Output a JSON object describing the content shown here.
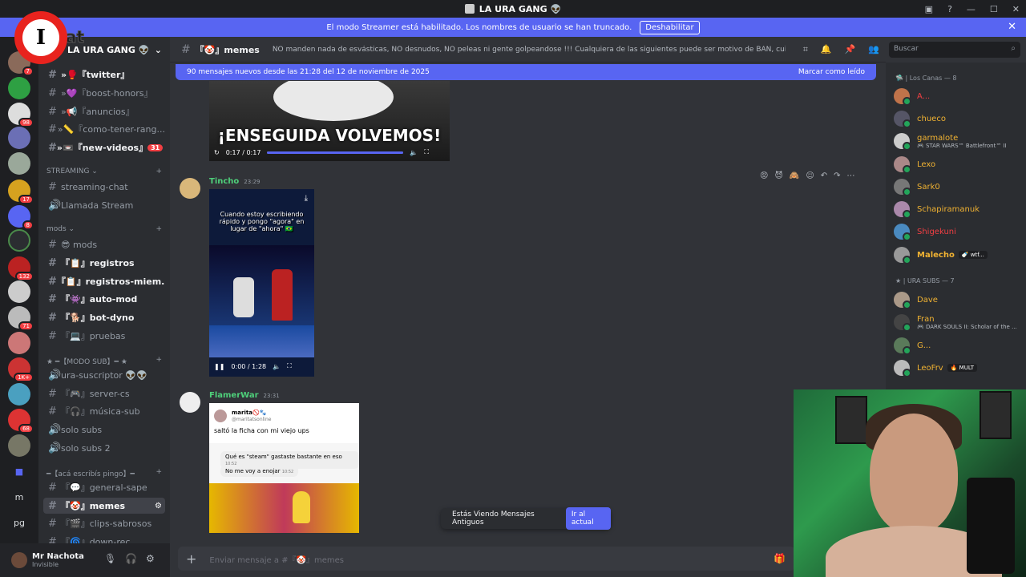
{
  "titlebar": {
    "title": "LA URA GANG 👽"
  },
  "banner": {
    "text": "El modo Streamer está habilitado. Los nombres de usuario se han truncado.",
    "button": "Deshabilitar",
    "close": "✕"
  },
  "logo": {
    "letter": "I",
    "text": "sat"
  },
  "server_badges": [
    "7",
    "98",
    "17",
    "8",
    "132",
    "71",
    "1K+",
    "68"
  ],
  "server_text": [
    "m",
    "pg"
  ],
  "guild": {
    "name": "LA URA GANG 👽"
  },
  "channels": {
    "top": [
      {
        "label": "»🥊『twitter』",
        "bold": true
      },
      {
        "label": "»💜『boost-honors』",
        "bold": false
      },
      {
        "label": "»📢『anuncios』",
        "bold": false
      },
      {
        "label": "»📏『como-tener-rang...",
        "bold": false
      },
      {
        "label": "»📼『new-videos』",
        "bold": true,
        "count": "31"
      }
    ],
    "streaming_cat": "STREAMING ⌄",
    "streaming": [
      "streaming-chat",
      "Llamada Stream"
    ],
    "mods_cat": "mods ⌄",
    "mods": [
      {
        "label": "😎 mods",
        "bold": false
      },
      {
        "label": "『📋』registros",
        "bold": true
      },
      {
        "label": "『📋』registros-miem...",
        "bold": true
      },
      {
        "label": "『👾』auto-mod",
        "bold": true
      },
      {
        "label": "『🐕』bot-dyno",
        "bold": true
      },
      {
        "label": "『💻』pruebas",
        "bold": false
      }
    ],
    "modosub_cat": "★ ━【MODO SUB】━ ★",
    "modosub": [
      "ura-suscriptor 👽👽",
      "『🎮』server-cs",
      "『🎧』música-sub",
      "solo subs",
      "solo subs 2"
    ],
    "pingo_cat": "━【acá escribís pingo】━",
    "pingo": [
      "『💬』general-sape",
      "『🤡』memes",
      "『🎬』clips-sabrosos",
      "『🌀』down-rec"
    ]
  },
  "user": {
    "name": "Mr Nachota",
    "status": "Invisible"
  },
  "header": {
    "channel": "『🤡』memes",
    "topic": "NO manden nada de esvásticas, NO desnudos, NO peleas ni gente golpeandose !!! Cualquiera de las siguientes puede ser motivo de BAN, cuiden el stream!"
  },
  "search": {
    "placeholder": "Buscar"
  },
  "newbar": {
    "text": "90 mensajes nuevos desde las 21:28 del 12 de noviembre de 2025",
    "action": "Marcar como leído"
  },
  "video1": {
    "caption": "¡ENSEGUIDA VOLVEMOS!",
    "time": "0:17 / 0:17",
    "progress": 1.0
  },
  "msg2": {
    "author": "Tincho",
    "time": "23:29",
    "video_caption": "Cuando estoy escribiendo rápido y pongo \"agora\" en lugar de \"ahora\" 🇧🇷",
    "video_time": "0:00 / 1:28",
    "progress": 0.0
  },
  "msg3": {
    "author": "FlamerWar",
    "time": "23:31",
    "tweet_name": "marita🚫🐾",
    "tweet_handle": "@maritatsonline",
    "tweet_text": "saltó la ficha con mi viejo ups",
    "bubble1": "Qué es \"steam\" gastaste bastante en eso",
    "bubble1_time": "10:52",
    "bubble2": "No me voy a enojar",
    "bubble2_time": "10:52"
  },
  "oldpill": {
    "text": "Estás Viendo Mensajes Antiguos",
    "button": "Ir al actual"
  },
  "composer": {
    "placeholder": "Enviar mensaje a #『🤡』memes"
  },
  "members": {
    "cat1": "🛸 | Los Canas — 8",
    "group1": [
      {
        "name": "A...",
        "color": "#f23f43"
      },
      {
        "name": "chueco",
        "color": "#f0b232"
      },
      {
        "name": "garmalote",
        "color": "#f0b232",
        "sub": "🎮 STAR WARS™ Battlefront™ II"
      },
      {
        "name": "Lexo",
        "color": "#f0b232"
      },
      {
        "name": "Sark0",
        "color": "#f0b232"
      },
      {
        "name": "Schapiramanuk",
        "color": "#f0b232"
      },
      {
        "name": "Shigekuni",
        "color": "#f23f43"
      },
      {
        "name": "Malecho",
        "color": "#f0b232",
        "tag": "🍼 wtf..."
      }
    ],
    "cat2": "★ | URA SUBS — 7",
    "group2": [
      {
        "name": "Dave",
        "color": "#f0b232"
      },
      {
        "name": "Fran",
        "color": "#f0b232",
        "sub": "🎮 DARK SOULS II: Scholar of the ..."
      },
      {
        "name": "G...",
        "color": "#f0b232"
      },
      {
        "name": "LeoFrv",
        "color": "#f0b232",
        "tag": "🔥 MULT"
      }
    ]
  }
}
